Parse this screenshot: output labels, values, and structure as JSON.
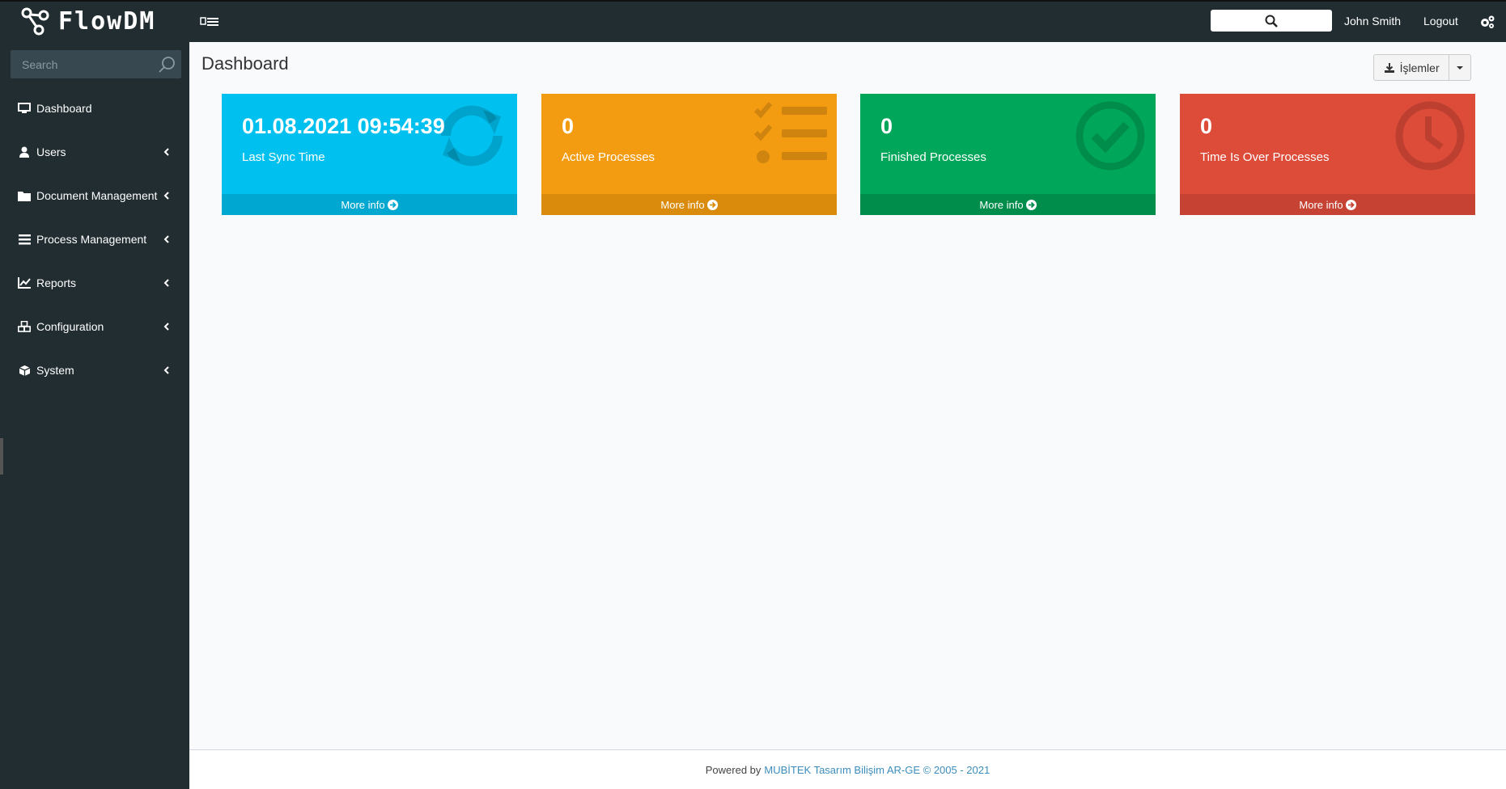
{
  "app": {
    "brand": "FlowDM"
  },
  "topbar": {
    "user_name": "John Smith",
    "logout_label": "Logout",
    "search_icon": "search-icon",
    "settings_icon": "gears-icon"
  },
  "sidebar": {
    "search_placeholder": "Search",
    "items": [
      {
        "label": "Dashboard",
        "icon": "desktop-icon",
        "has_children": false
      },
      {
        "label": "Users",
        "icon": "user-icon",
        "has_children": true
      },
      {
        "label": "Document Management",
        "icon": "folder-icon",
        "has_children": true
      },
      {
        "label": "Process Management",
        "icon": "list-icon",
        "has_children": true
      },
      {
        "label": "Reports",
        "icon": "line-chart-icon",
        "has_children": true
      },
      {
        "label": "Configuration",
        "icon": "cubes-icon",
        "has_children": true
      },
      {
        "label": "System",
        "icon": "cube-icon",
        "has_children": true
      }
    ]
  },
  "page": {
    "title": "Dashboard",
    "actions_label": "İşlemler"
  },
  "boxes": [
    {
      "value": "01.08.2021 09:54:39",
      "label": "Last Sync Time",
      "footer": "More info",
      "color": "#00c0ef",
      "footer_color": "#00a7d0",
      "icon": "refresh-icon"
    },
    {
      "value": "0",
      "label": "Active Processes",
      "footer": "More info",
      "color": "#f39c12",
      "footer_color": "#db8b0b",
      "icon": "tasks-icon"
    },
    {
      "value": "0",
      "label": "Finished Processes",
      "footer": "More info",
      "color": "#00a65a",
      "footer_color": "#008d4c",
      "icon": "check-circle-icon"
    },
    {
      "value": "0",
      "label": "Time Is Over Processes",
      "footer": "More info",
      "color": "#dd4b39",
      "footer_color": "#c64333",
      "icon": "clock-icon"
    }
  ],
  "footer": {
    "prefix": "Powered by",
    "brand": "MUBİTEK Tasarım Bilişim AR-GE © 2005 - 2021"
  }
}
